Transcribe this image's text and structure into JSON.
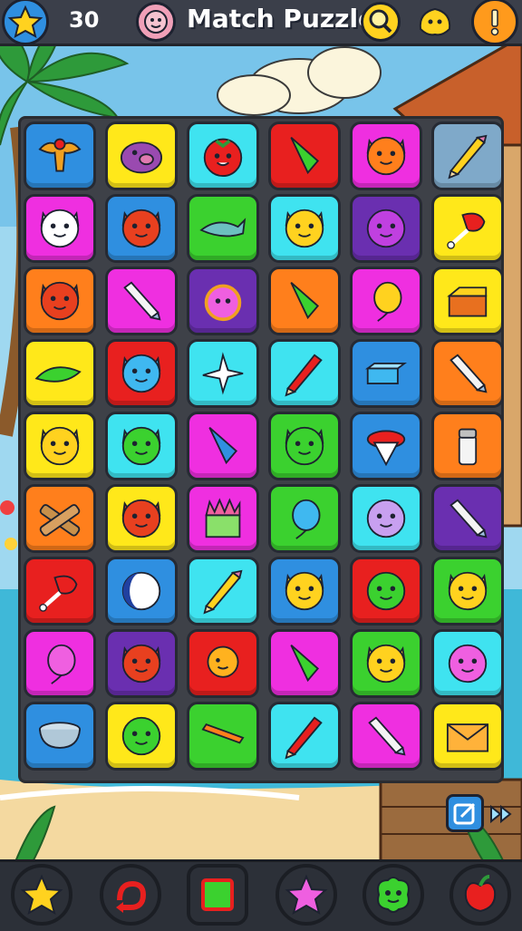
{
  "header": {
    "score": "30",
    "title": "Match Puzzle"
  },
  "colors": {
    "blue": "#2f8fe0",
    "yellow": "#ffe81a",
    "cyan": "#3fe3f0",
    "red": "#e8201f",
    "magenta": "#ef2fe0",
    "slate": "#7fa9c9",
    "green": "#3bd12f",
    "purple": "#6a2fb0",
    "orange": "#ff7f1c"
  },
  "board": {
    "rows": [
      [
        {
          "color": "blue",
          "item": "eagle-emblem"
        },
        {
          "color": "yellow",
          "item": "purple-pig"
        },
        {
          "color": "cyan",
          "item": "tomato-face"
        },
        {
          "color": "red",
          "item": "green-cone"
        },
        {
          "color": "magenta",
          "item": "orange-cat-face"
        },
        {
          "color": "slate",
          "item": "pencil"
        }
      ],
      [
        {
          "color": "magenta",
          "item": "white-cat-face"
        },
        {
          "color": "blue",
          "item": "red-cat-face"
        },
        {
          "color": "green",
          "item": "fish"
        },
        {
          "color": "cyan",
          "item": "yellow-cat-face"
        },
        {
          "color": "purple",
          "item": "purple-ball"
        },
        {
          "color": "yellow",
          "item": "drumstick"
        }
      ],
      [
        {
          "color": "orange",
          "item": "red-cat-face"
        },
        {
          "color": "magenta",
          "item": "chalk-stick"
        },
        {
          "color": "purple",
          "item": "alarm-clock-face"
        },
        {
          "color": "orange",
          "item": "green-cone"
        },
        {
          "color": "magenta",
          "item": "yellow-balloon"
        },
        {
          "color": "yellow",
          "item": "open-box"
        }
      ],
      [
        {
          "color": "yellow",
          "item": "green-leaf"
        },
        {
          "color": "red",
          "item": "blue-cat-face"
        },
        {
          "color": "cyan",
          "item": "white-star"
        },
        {
          "color": "cyan",
          "item": "red-pencil"
        },
        {
          "color": "blue",
          "item": "blue-block"
        },
        {
          "color": "orange",
          "item": "chalk-stick"
        }
      ],
      [
        {
          "color": "yellow",
          "item": "yellow-cat-face"
        },
        {
          "color": "cyan",
          "item": "green-cat-face"
        },
        {
          "color": "magenta",
          "item": "blue-cone"
        },
        {
          "color": "green",
          "item": "green-cat-face"
        },
        {
          "color": "blue",
          "item": "spinning-top"
        },
        {
          "color": "orange",
          "item": "salt-shaker"
        }
      ],
      [
        {
          "color": "orange",
          "item": "crossed-logs"
        },
        {
          "color": "yellow",
          "item": "red-cat-face"
        },
        {
          "color": "magenta",
          "item": "grass-box"
        },
        {
          "color": "green",
          "item": "blue-balloon"
        },
        {
          "color": "cyan",
          "item": "lilac-ball"
        },
        {
          "color": "purple",
          "item": "chalk-stick"
        }
      ],
      [
        {
          "color": "red",
          "item": "drumstick"
        },
        {
          "color": "blue",
          "item": "moon-ball"
        },
        {
          "color": "cyan",
          "item": "pencil"
        },
        {
          "color": "blue",
          "item": "yellow-cat-face"
        },
        {
          "color": "red",
          "item": "green-winking-ball"
        },
        {
          "color": "green",
          "item": "yellow-cat-face"
        }
      ],
      [
        {
          "color": "magenta",
          "item": "pink-balloon"
        },
        {
          "color": "purple",
          "item": "red-cat-face"
        },
        {
          "color": "red",
          "item": "orange-balloon"
        },
        {
          "color": "magenta",
          "item": "green-cone"
        },
        {
          "color": "green",
          "item": "yellow-cat-face"
        },
        {
          "color": "cyan",
          "item": "pink-ball"
        }
      ],
      [
        {
          "color": "blue",
          "item": "metal-bowl"
        },
        {
          "color": "yellow",
          "item": "green-winking-ball"
        },
        {
          "color": "green",
          "item": "carrot-stick"
        },
        {
          "color": "cyan",
          "item": "red-pencil"
        },
        {
          "color": "magenta",
          "item": "chalk-stick"
        },
        {
          "color": "yellow",
          "item": "envelope"
        }
      ]
    ]
  },
  "bottom_bar": {
    "buttons": [
      {
        "name": "star",
        "color": "#2f8fe0"
      },
      {
        "name": "swap",
        "color": "#3bd12f"
      },
      {
        "name": "square",
        "color": "#2f8fe0"
      },
      {
        "name": "pink-star",
        "color": "#2f8fe0"
      },
      {
        "name": "green-blob",
        "color": "#6a2fb0"
      },
      {
        "name": "apple",
        "color": "#2f8fe0"
      }
    ]
  }
}
